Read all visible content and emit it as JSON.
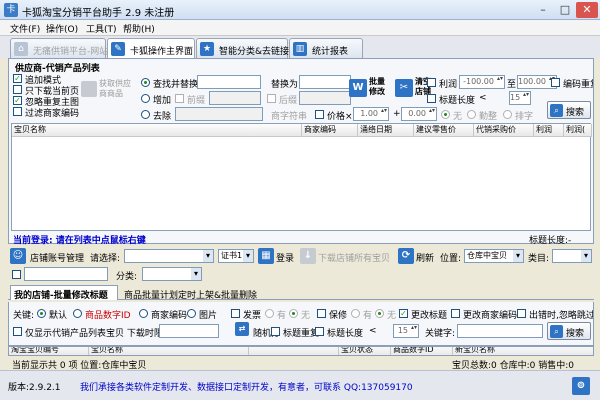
{
  "window": {
    "title": "卡狐淘宝分销平台助手 2.9 未注册",
    "min": "–",
    "max": "□",
    "close": "✕"
  },
  "menu": [
    "文件(F)",
    "操作(O)",
    "工具(T)",
    "帮助(H)"
  ],
  "tabs": [
    {
      "label": "无痛供销平台-网站",
      "state": "disabled"
    },
    {
      "label": "卡狐操作主界面",
      "state": "active"
    },
    {
      "label": "智能分类&去链接",
      "state": "normal"
    },
    {
      "label": "统计报表",
      "state": "normal"
    }
  ],
  "supplier": {
    "group_title": "供应商-代销产品列表",
    "checks": [
      {
        "label": "追加模式",
        "checked": true
      },
      {
        "label": "只下载当前页",
        "checked": false
      },
      {
        "label": "忽略重复主图",
        "checked": true
      },
      {
        "label": "过滤商家编码",
        "checked": false
      }
    ],
    "get_btn": "获取供应商商品",
    "replace": {
      "find_label": "查找并替换",
      "replace_with_label": "替换为",
      "add_label": "增加",
      "prefix_label": "前缀",
      "suffix_label": "后缀",
      "delete_label": "去除",
      "sample_placeholder": "商字符串",
      "price_label": "价格×",
      "price_mult": "1.00",
      "price_plus_label": "+",
      "price_add": "0.00",
      "batch_btn": "批量修改",
      "clear_btn": "清空店铺",
      "profit_label": "利润",
      "profit_min": "-100.00",
      "profit_to": "至",
      "profit_max": "100.00",
      "title_len_label": "标题长度",
      "title_len_val": "15",
      "opt_none": "无",
      "opt_up": "勤整",
      "opt_sort": "排字",
      "edit_check_label": "编码重复",
      "search_btn": "搜索"
    },
    "columns": [
      "宝贝名称",
      "商家编码",
      "涌络日期",
      "建议零售价",
      "代销采购价",
      "利润",
      "利润("
    ],
    "status_left": "当前登录: 请在列表中点鼠标右键",
    "status_right": "标题长度:-"
  },
  "store": {
    "manage_label": "店铺账号管理",
    "choose_label": "请选择:",
    "cert_val": "证书1",
    "login_btn": "登录",
    "download_btn": "下载店铺所有宝贝",
    "refresh_btn": "刷新",
    "position_label": "位置:",
    "position_val": "仓库中宝贝",
    "category_label": "类目:",
    "class_label": "分类:",
    "subtabs": [
      "我的店铺-批量修改标题",
      "商品批量计划定时上架&批量删除"
    ],
    "keyword_label": "关键:",
    "radios": [
      {
        "label": "默认",
        "on": true
      },
      {
        "label": "商品数字ID",
        "on": false,
        "red": true
      },
      {
        "label": "商家编码",
        "on": false
      },
      {
        "label": "图片",
        "on": false
      }
    ],
    "invoice_label": "发票",
    "warranty_label": "保修",
    "opt_have": "有",
    "opt_no": "无",
    "change_title_label": "更改标题",
    "change_code_label": "更改商家编码",
    "out_of_stock_label": "出错时,忽略跳过",
    "only_show_label": "仅显示代销产品列表宝贝 下载时限制:",
    "random_label": "随机分",
    "title_repeat_label": "标题重复",
    "title_len_label": "标题长度",
    "title_len_val": "15",
    "keyword_search_label": "关键字:",
    "search_btn": "搜索",
    "columns": [
      "淘宝宝贝编号",
      "宝贝名称",
      "",
      "宝贝状态",
      "商品数字ID",
      "新宝贝名称"
    ],
    "status": {
      "left": "当前显示共 0 项 位置:仓库中宝贝",
      "right": "宝贝总数:0 仓库中:0 销售中:0"
    }
  },
  "footer": {
    "version": "版本:2.9.2.1",
    "ad": "我们承接各类软件定制开发、数据接口定制开发，有意者，可联系 QQ:137059170"
  },
  "colors": {
    "accent": "#2e73c4",
    "link": "#0000cc",
    "panel_border": "#8c9fb8"
  }
}
